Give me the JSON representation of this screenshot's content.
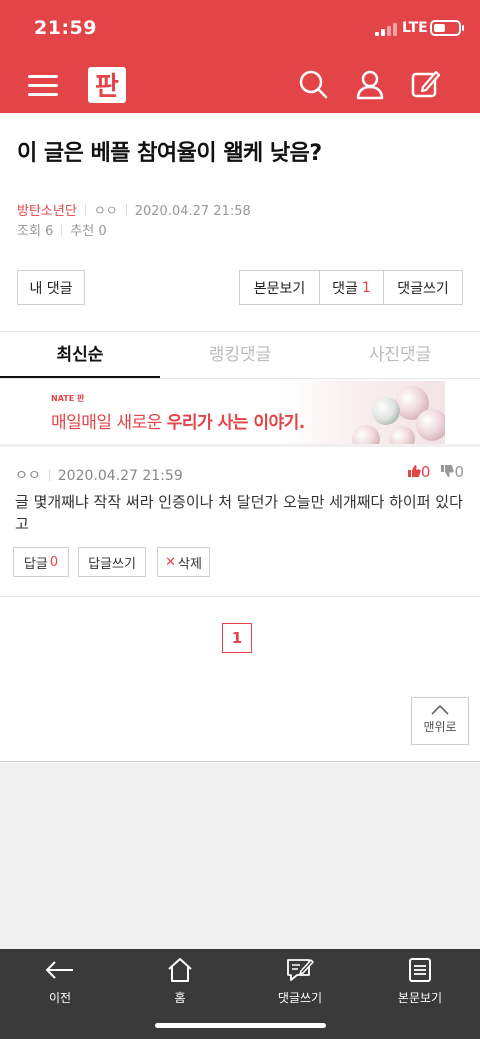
{
  "status": {
    "time": "21:59",
    "network": "LTE"
  },
  "header": {
    "logo_alt": "판"
  },
  "post": {
    "title": "이 글은 베플 참여율이 왤케 낮음?",
    "board": "방탄소년단",
    "author": "ㅇㅇ",
    "datetime": "2020.04.27 21:58",
    "views_label": "조회",
    "views": "6",
    "recommend_label": "추천",
    "recommend": "0"
  },
  "actions": {
    "my_comments": "내 댓글",
    "view_post": "본문보기",
    "comments_label": "댓글",
    "comments_count": "1",
    "write_comment": "댓글쓰기"
  },
  "tabs": [
    {
      "label": "최신순",
      "active": true
    },
    {
      "label": "랭킹댓글",
      "active": false
    },
    {
      "label": "사진댓글",
      "active": false
    }
  ],
  "banner": {
    "brand": "NATE 판",
    "text_plain": "매일매일 새로운 ",
    "text_bold": "우리가 사는 이야기."
  },
  "comment": {
    "author": "ㅇㅇ",
    "datetime": "2020.04.27 21:59",
    "likes": "0",
    "dislikes": "0",
    "body": "글 몇개째냐 작작 써라 인증이나 처 달던가 오늘만 세개째다 하이퍼 있다고",
    "reply_label": "답글",
    "reply_count": "0",
    "write_reply": "답글쓰기",
    "delete": "삭제"
  },
  "pagination": {
    "current": "1"
  },
  "to_top": "맨위로",
  "bottom_nav": [
    {
      "label": "이전",
      "icon": "back-arrow-icon"
    },
    {
      "label": "홈",
      "icon": "home-icon"
    },
    {
      "label": "댓글쓰기",
      "icon": "write-comment-icon"
    },
    {
      "label": "본문보기",
      "icon": "document-icon"
    }
  ],
  "colors": {
    "brand": "#e24447",
    "bottom_bar": "#3a3a3a"
  }
}
